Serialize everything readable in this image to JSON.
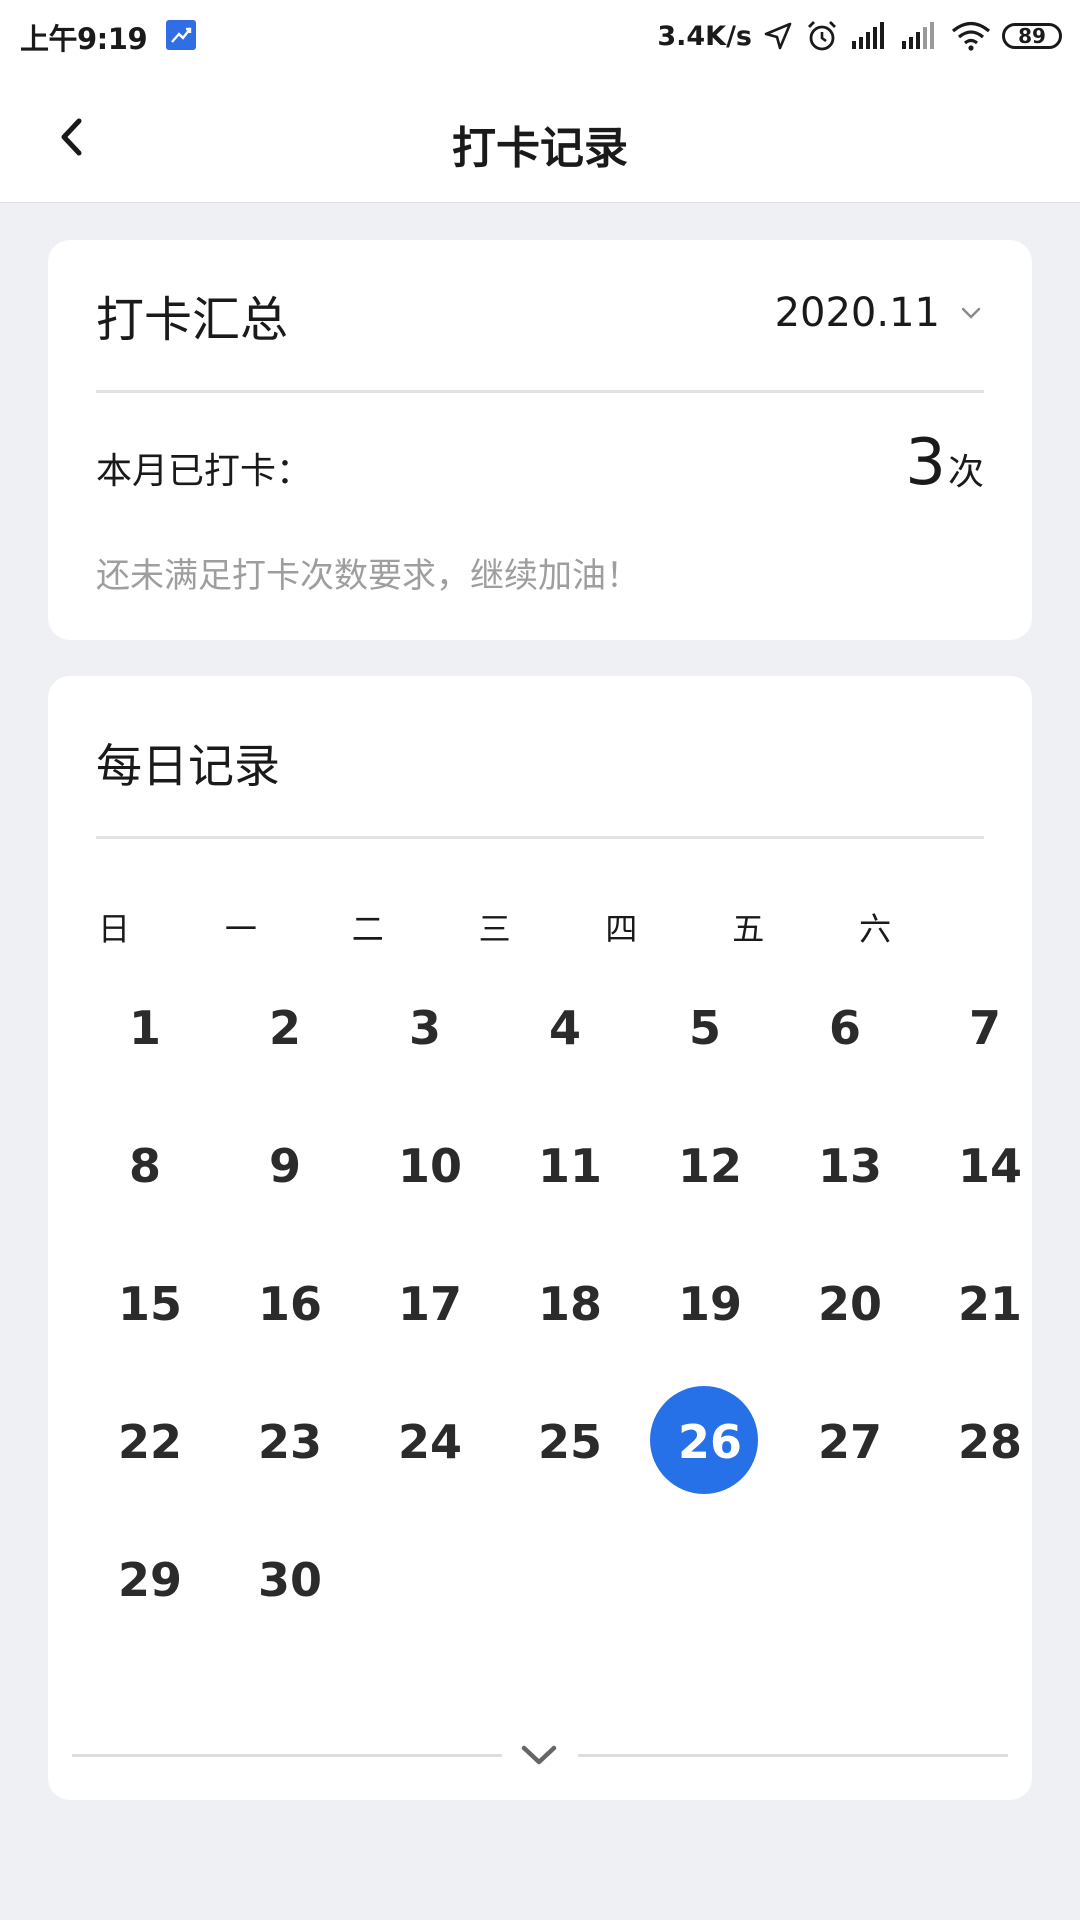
{
  "status_bar": {
    "time": "上午9:19",
    "net_speed": "3.4K/s",
    "battery": "89",
    "icons": [
      "app-notification-icon",
      "location-arrow-icon",
      "alarm-icon",
      "signal-icon",
      "signal-icon",
      "wifi-icon",
      "battery-icon"
    ]
  },
  "nav": {
    "title": "打卡记录",
    "back_icon": "chevron-left-icon"
  },
  "summary": {
    "title": "打卡汇总",
    "month": "2020.11",
    "checked_label": "本月已打卡：",
    "checked_count": "3",
    "checked_unit": "次",
    "hint": "还未满足打卡次数要求，继续加油！"
  },
  "calendar": {
    "title": "每日记录",
    "weekdays": [
      "日",
      "一",
      "二",
      "三",
      "四",
      "五",
      "六"
    ],
    "days": [
      "1",
      "2",
      "3",
      "4",
      "5",
      "6",
      "7",
      "8",
      "9",
      "10",
      "11",
      "12",
      "13",
      "14",
      "15",
      "16",
      "17",
      "18",
      "19",
      "20",
      "21",
      "22",
      "23",
      "24",
      "25",
      "26",
      "27",
      "28",
      "29",
      "30"
    ],
    "selected_day": "26",
    "accent_color": "#2670e8",
    "expand_icon": "chevron-down-icon"
  }
}
